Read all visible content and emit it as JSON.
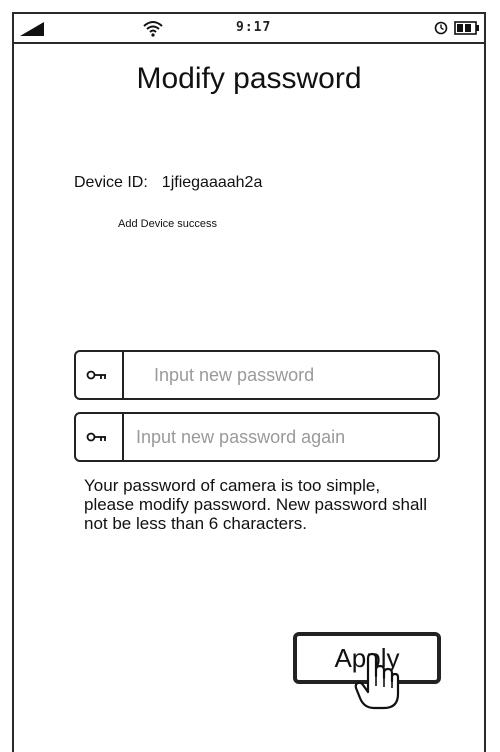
{
  "status_bar": {
    "time": "9:17",
    "icons": [
      "signal-icon",
      "wifi-icon",
      "alarm-icon",
      "battery-icon"
    ]
  },
  "page_title": "Modify password",
  "device": {
    "label": "Device ID:",
    "id": "1jfiegaaaah2a",
    "status": "Add Device success"
  },
  "fields": {
    "new_password": {
      "value": "",
      "placeholder": "Input new password",
      "icon": "key-icon"
    },
    "confirm_password": {
      "value": "",
      "placeholder": "Input new password again",
      "icon": "key-icon"
    }
  },
  "warning_text": "Your password of camera is too simple, please modify password. New password shall not be less than 6 characters.",
  "apply_button": {
    "label": "Apply"
  },
  "cursor": "hand-pointer-icon"
}
